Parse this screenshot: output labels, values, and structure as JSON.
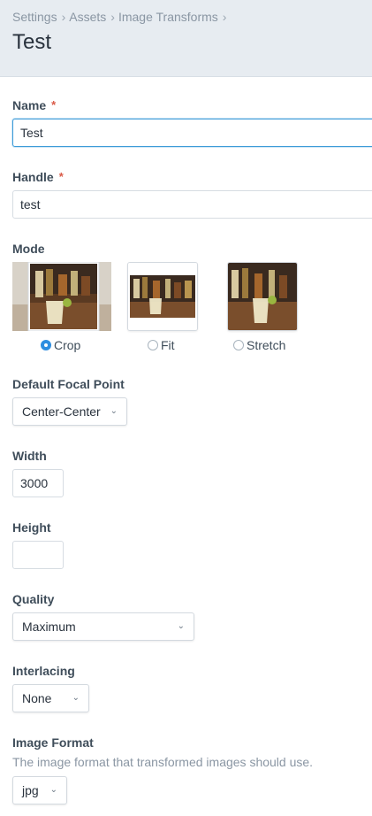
{
  "header": {
    "breadcrumbs": [
      "Settings",
      "Assets",
      "Image Transforms"
    ],
    "breadcrumb_separator": "›",
    "title": "Test"
  },
  "fields": {
    "name": {
      "label": "Name",
      "value": "Test",
      "required_marker": "*"
    },
    "handle": {
      "label": "Handle",
      "value": "test",
      "required_marker": "*"
    },
    "mode": {
      "label": "Mode",
      "options": [
        {
          "label": "Crop",
          "checked": true
        },
        {
          "label": "Fit",
          "checked": false
        },
        {
          "label": "Stretch",
          "checked": false
        }
      ]
    },
    "focal_point": {
      "label": "Default Focal Point",
      "value": "Center-Center"
    },
    "width": {
      "label": "Width",
      "value": "3000"
    },
    "height": {
      "label": "Height",
      "value": ""
    },
    "quality": {
      "label": "Quality",
      "value": "Maximum"
    },
    "interlacing": {
      "label": "Interlacing",
      "value": "None"
    },
    "image_format": {
      "label": "Image Format",
      "instructions": "The image format that transformed images should use.",
      "value": "jpg"
    }
  },
  "icons": {
    "select_chevron": "chevron-down-icon",
    "required": "asterisk-icon"
  },
  "colors": {
    "header_bg": "#e7ecf1",
    "accent_blue": "#2e8ee0",
    "required_red": "#da5a47",
    "focus_border": "#3d9bd8"
  }
}
